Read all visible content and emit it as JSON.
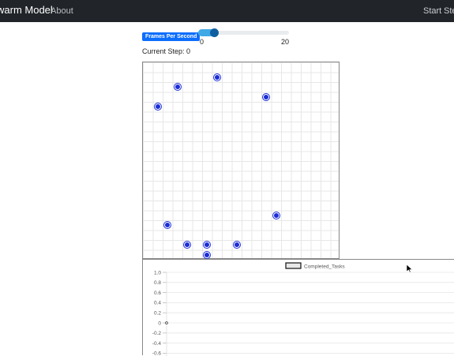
{
  "navbar": {
    "brand": "warm Model",
    "links": [
      "About"
    ],
    "right_links": [
      "Start",
      "Ste"
    ]
  },
  "controls": {
    "fps_label": "Frames Per Second",
    "slider_min": "0",
    "slider_max": "20",
    "slider_value": 3,
    "current_step_label": "Current Step: 0"
  },
  "grid": {
    "agent_color": "#1b2dd6",
    "agent_glyph": "rabbit-icon",
    "agents": [
      {
        "col": 1,
        "row": 4
      },
      {
        "col": 3,
        "row": 2
      },
      {
        "col": 7,
        "row": 1
      },
      {
        "col": 12,
        "row": 3
      },
      {
        "col": 13,
        "row": 15
      },
      {
        "col": 2,
        "row": 16
      },
      {
        "col": 4,
        "row": 18
      },
      {
        "col": 6,
        "row": 18
      },
      {
        "col": 6,
        "row": 19
      },
      {
        "col": 9,
        "row": 18
      }
    ]
  },
  "chart_data": {
    "type": "line",
    "series": [
      {
        "name": "Completed_Tasks",
        "values": [
          0
        ]
      }
    ],
    "x": [
      0
    ],
    "yticks": [
      "1.0",
      "0.8",
      "0.6",
      "0.4",
      "0.2",
      "0",
      "-0.2",
      "-0.4",
      "-0.6"
    ],
    "ylim": [
      -0.6,
      1.0
    ],
    "grid": true,
    "legend": "top"
  }
}
